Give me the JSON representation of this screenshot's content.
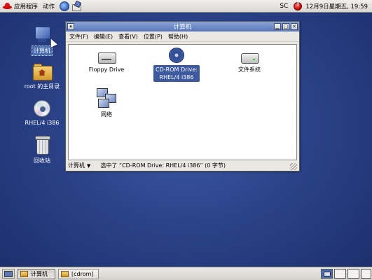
{
  "top_panel": {
    "apps_label": "应用程序",
    "actions_label": "动作",
    "sc_label": "SC",
    "clock": "12月9日星期五, 19:59"
  },
  "desktop": {
    "icons": [
      {
        "label": "计算机"
      },
      {
        "label": "root 的主目录"
      },
      {
        "label": "RHEL/4 i386"
      },
      {
        "label": "回收站"
      }
    ]
  },
  "window": {
    "title": "计算机",
    "menus": [
      "文件(F)",
      "编辑(E)",
      "查看(V)",
      "位置(P)",
      "帮助(H)"
    ],
    "items": [
      {
        "label": "Floppy Drive"
      },
      {
        "label": "CD-ROM Drive:",
        "label2": "RHEL/4 i386"
      },
      {
        "label": "文件系统"
      },
      {
        "label": "网络"
      }
    ],
    "status": {
      "location": "计算机",
      "message": "选中了 “CD-ROM Drive: RHEL/4 i386”  (0 字节)"
    }
  },
  "taskbar": {
    "tasks": [
      {
        "label": "计算机"
      },
      {
        "label": "[cdrom]"
      }
    ]
  }
}
